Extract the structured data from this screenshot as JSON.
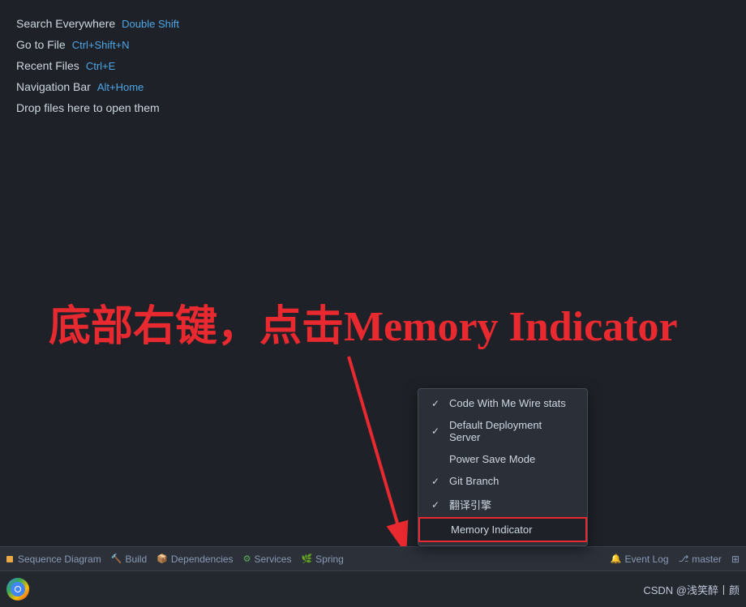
{
  "menu": {
    "items": [
      {
        "label": "Search Everywhere",
        "shortcut": "Double Shift"
      },
      {
        "label": "Go to File",
        "shortcut": "Ctrl+Shift+N"
      },
      {
        "label": "Recent Files",
        "shortcut": "Ctrl+E"
      },
      {
        "label": "Navigation Bar",
        "shortcut": "Alt+Home"
      },
      {
        "label": "Drop files here to open them",
        "shortcut": ""
      }
    ]
  },
  "annotation": {
    "text": "底部右键，点击Memory Indicator"
  },
  "context_menu": {
    "items": [
      {
        "label": "Code With Me Wire stats",
        "checked": true
      },
      {
        "label": "Default Deployment Server",
        "checked": true
      },
      {
        "label": "Power Save Mode",
        "checked": false
      },
      {
        "label": "Git Branch",
        "checked": true
      },
      {
        "label": "翻译引擎",
        "checked": true
      },
      {
        "label": "Memory Indicator",
        "checked": false,
        "highlighted": true
      }
    ]
  },
  "status_bar": {
    "items": [
      {
        "icon": "📊",
        "label": "Sequence Diagram"
      },
      {
        "icon": "🔨",
        "label": "Build"
      },
      {
        "icon": "📦",
        "label": "Dependencies"
      },
      {
        "icon": "⚙️",
        "label": "Services"
      },
      {
        "icon": "🌿",
        "label": "Spring"
      }
    ],
    "right_items": [
      {
        "label": "Event Log"
      },
      {
        "label": "master"
      }
    ]
  },
  "taskbar": {
    "chrome_label": "",
    "taskbar_text": "",
    "right_text": "CSDN @浅笑醉丨颜"
  }
}
